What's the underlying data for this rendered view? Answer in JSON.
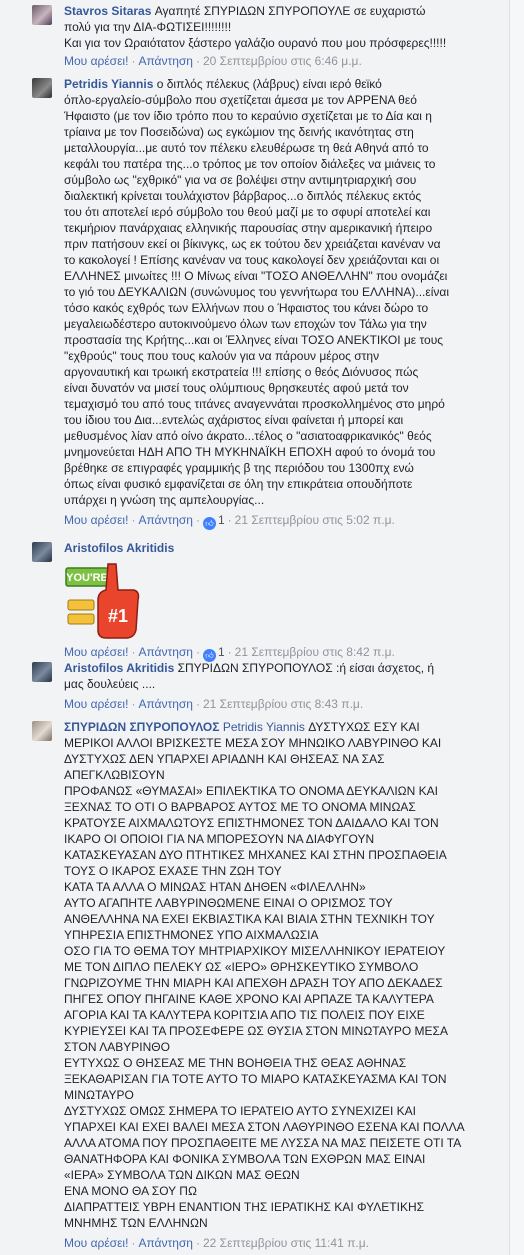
{
  "actions": {
    "like": "Μου αρέσει!",
    "reply": "Απάντηση"
  },
  "comments": [
    {
      "author": "Stavros Sitaras",
      "lines": [
        "Αγαπητέ ΣΠΥΡΙΔΩΝ ΣΠΥΡΟΠΟΥΛΕ σε ευχαριστώ",
        "πολύ για την ΔΙΑ-ΦΩΤΙΣΕΙ!!!!!!!!",
        "Και για τον Ωραιότατον ξάστερο γαλάζιο ουρανό που μου πρόσφερες!!!!!"
      ],
      "timestamp": "20 Σεπτεμβρίου στις 6:46 μ.μ."
    },
    {
      "author": "Petridis Yiannis",
      "lines": [
        "ο διπλός πέλεκυς (λάβρυς) είναι ιερό θεϊκό",
        "όπλο-εργαλείο-σύμβολο που σχετίζεται άμεσα με τον ΑΡΡΕΝΑ θεό",
        "Ήφαιστο (με τον ίδιο τρόπο που το κεραύνιο σχετίζεται με το Δία και η",
        "τρίαινα με τον Ποσειδώνα) ως εγκώμιον της δεινής ικανότητας στη",
        "μεταλλουργία...με αυτό τον πέλεκυ ελευθέρωσε τη θεά Αθηνά από το",
        "κεφάλι του πατέρα της...ο τρόπος με τον οποίον διάλεξες να μιάνεις το",
        "σύμβολο ως \"εχθρικό\" για να σε βολέψει στην αντιμητριαρχική σου",
        "διαλεκτική κρίνεται τουλάχιστον βάρβαρος...ο διπλός πέλεκυς εκτός",
        "του ότι αποτελεί ιερό σύμβολο του θεού μαζί με το σφυρί αποτελεί και",
        "τεκμήριον πανάρχαιας ελληνικής παρουσίας στην αμερικανική ήπειρο",
        "πριν πατήσουν εκεί οι βίκινγκς, ως εκ τούτου δεν χρειάζεται κανέναν να",
        "το κακολογεί ! Επίσης κανέναν να τους κακολογεί δεν χρειάζονται και οι",
        "ΕΛΛΗΝΕΣ μινωίτες !!! Ο Μίνως είναι \"ΤΟΣΟ ΑΝΘΕΛΛΗΝ\" που ονομάζει",
        "το γιό του ΔΕΥΚΑΛΙΩΝ (συνώνυμος του γεννήτωρα του ΕΛΛΗΝΑ)...είναι",
        "τόσο κακός εχθρός των Ελλήνων που ο Ήφαιστος του κάνει δώρο το",
        "μεγαλειωδέστερο αυτοκινούμενο όλων των εποχών τον Τάλω για την",
        "προστασία της Κρήτης...και οι Έλληνες είναι ΤΟΣΟ ΑΝΕΚΤΙΚΟΙ με τους",
        "\"εχθρούς\" τους που τους καλούν για να πάρουν μέρος στην",
        "αργοναυτική και τρωική εκστρατεία !!! επίσης ο θεός Διόνυσος πώς",
        "είναι δυνατόν να μισεί τους ολύμπιους θρησκευτές αφού μετά τον",
        "τεμαχισμό του από τους τιτάνες αναγεννάται προσκολλημένος στο μηρό",
        "του ίδιου του Δια...εντελώς αχάριστος είναι φαίνεται ή μπορεί και",
        "μεθυσμένος λίαν από οίνο άκρατο...τέλος ο \"ασιατοαφρικανικός\" θεός",
        "μνημονεύεται ΗΔΗ ΑΠΟ ΤΗ ΜΥΚΗΝΑΪΚΗ ΕΠΟΧΗ αφού το όνομά του",
        "βρέθηκε σε επιγραφές γραμμικής β της περιόδου του 1300πχ ενώ",
        "όπως είναι φυσικό εμφανίζεται σε όλη την επικράτεια οπουδήποτε",
        "υπάρχει η γνώση της αμπελουργίας..."
      ],
      "likes": "1",
      "timestamp": "21 Σεπτεμβρίου στις 5:02 π.μ."
    },
    {
      "author": "Aristofilos Akritidis",
      "sticker_text": "YOU'RE #1",
      "likes": "1",
      "timestamp": "21 Σεπτεμβρίου στις 8:42 π.μ."
    },
    {
      "author": "Aristofilos Akritidis",
      "lines": [
        "ΣΠΥΡΙΔΩΝ ΣΠΥΡΟΠΟΥΛΟΣ :ή είσαι άσχετος, ή",
        "μας δουλεύεις ...."
      ],
      "timestamp": "21 Σεπτεμβρίου στις 8:43 π.μ."
    },
    {
      "author": "ΣΠΥΡΙΔΩΝ ΣΠΥΡΟΠΟΥΛΟΣ",
      "mention": "Petridis Yiannis",
      "first_line_rest": "ΔΥΣΤΥΧΩΣ ΕΣΥ ΚΑΙ",
      "lines": [
        "ΜΕΡΙΚΟΙ ΑΛΛΟΙ ΒΡΙΣΚΕΣΤΕ ΜΕΣΑ ΣΟΥ ΜΗΝΩΙΚΟ ΛΑΒΥΡΙΝΘΟ ΚΑΙ",
        "ΔΥΣΤΥΧΩΣ ΔΕΝ ΥΠΑΡΧΕΙ ΑΡΙΑΔΝΗ ΚΑΙ ΘΗΣΕΑΣ ΝΑ ΣΑΣ",
        "ΑΠΕΓΚΛΩΒΙΣΟΥΝ",
        "ΠΡΟΦΑΝΩΣ «ΘΥΜΑΣΑΙ» ΕΠΙΛΕΚΤΙΚΑ ΤΟ ΟΝΟΜΑ ΔΕΥΚΑΛΙΩΝ ΚΑΙ",
        "ΞΕΧΝΑΣ ΤΟ ΟΤΙ Ο ΒΑΡΒΑΡΟΣ ΑΥΤΟΣ ΜΕ ΤΟ ΟΝΟΜΑ ΜΙΝΩΑΣ",
        "ΚΡΑΤΟΥΣΕ ΑΙΧΜΑΛΩΤΟΥΣ ΕΠΙΣΤΗΜΟΝΕΣ ΤΟΝ ΔΑΙΔΑΛΟ ΚΑΙ ΤΟΝ",
        "ΙΚΑΡΟ ΟΙ ΟΠΟΙΟΙ ΓΙΑ ΝΑ ΜΠΟΡΕΣΟΥΝ ΝΑ ΔΙΑΦΥΓΟΥΝ",
        "ΚΑΤΑΣΚΕΥΑΣΑΝ ΔΥΟ ΠΤΗΤΙΚΕΣ ΜΗΧΑΝΕΣ ΚΑΙ ΣΤΗΝ ΠΡΟΣΠΑΘΕΙΑ",
        "ΤΟΥΣ Ο ΙΚΑΡΟΣ ΕΧΑΣΕ ΤΗΝ ΖΩΗ ΤΟΥ",
        "ΚΑΤΑ ΤΑ ΑΛΛΑ Ο ΜΙΝΩΑΣ ΗΤΑΝ ΔΗΘΕΝ «ΦΙΛΕΛΛΗΝ»",
        "ΑΥΤΟ ΑΓΑΠΗΤΕ ΛΑΒΥΡΙΝΘΩΜΕΝΕ ΕΙΝΑΙ Ο ΟΡΙΣΜΟΣ ΤΟΥ",
        "ΑΝΘΕΛΛΗΝΑ ΝΑ ΕΧΕΙ ΕΚΒΙΑΣΤΙΚΑ ΚΑΙ ΒΙΑΙΑ ΣΤΗΝ ΤΕΧΝΙΚΗ ΤΟΥ",
        "ΥΠΗΡΕΣΙΑ ΕΠΙΣΤΗΜΟΝΕΣ ΥΠΟ ΑΙΧΜΑΛΩΣΙΑ",
        "ΟΣΟ ΓΙΑ ΤΟ ΘΕΜΑ ΤΟΥ ΜΗΤΡΙΑΡΧΙΚΟΥ ΜΙΣΕΛΛΗΝΙΚΟΥ ΙΕΡΑΤΕΙΟΥ",
        "ΜΕ ΤΟΝ ΔΙΠΛΟ ΠΕΛΕΚΥ ΩΣ «ΙΕΡΟ» ΘΡΗΣΚΕΥΤΙΚΟ ΣΥΜΒΟΛΟ",
        "ΓΝΩΡΙΖΟΥΜΕ ΤΗΝ ΜΙΑΡΗ ΚΑΙ ΑΠΕΧΘΗ ΔΡΑΣΗ ΤΟΥ ΑΠΟ ΔΕΚΑΔΕΣ",
        "ΠΗΓΕΣ ΟΠΟΥ ΠΗΓΑΙΝΕ ΚΑΘΕ ΧΡΟΝΟ ΚΑΙ ΑΡΠΑΖΕ ΤΑ ΚΑΛΥΤΕΡΑ",
        "ΑΓΟΡΙΑ ΚΑΙ ΤΑ ΚΑΛΥΤΕΡΑ ΚΟΡΙΤΣΙΑ ΑΠΟ ΤΙΣ ΠΟΛΕΙΣ ΠΟΥ ΕΙΧΕ",
        "ΚΥΡΙΕΥΣΕΙ ΚΑΙ ΤΑ ΠΡΟΣΕΦΕΡΕ ΩΣ ΘΥΣΙΑ ΣΤΟΝ ΜΙΝΩΤΑΥΡΟ ΜΕΣΑ",
        "ΣΤΟΝ ΛΑΒΥΡΙΝΘΟ",
        "ΕΥΤΥΧΩΣ Ο ΘΗΣΕΑΣ ΜΕ ΤΗΝ ΒΟΗΘΕΙΑ ΤΗΣ ΘΕΑΣ ΑΘΗΝΑΣ",
        "ΞΕΚΑΘΑΡΙΣΑΝ ΓΙΑ ΤΟΤΕ ΑΥΤΟ ΤΟ ΜΙΑΡΟ ΚΑΤΑΣΚΕΥΑΣΜΑ ΚΑΙ ΤΟΝ",
        "ΜΙΝΩΤΑΥΡΟ",
        "ΔΥΣΤΥΧΩΣ ΟΜΩΣ ΣΗΜΕΡΑ ΤΟ ΙΕΡΑΤΕΙΟ ΑΥΤΟ ΣΥΝΕΧΙΖΕΙ ΚΑΙ",
        "ΥΠΑΡΧΕΙ ΚΑΙ ΕΧΕΙ ΒΑΛΕΙ ΜΕΣΑ ΣΤΟΝ ΛΑΘΥΡΙΝΘΟ ΕΣΕΝΑ ΚΑΙ ΠΟΛΛΑ",
        "ΑΛΛΑ ΑΤΟΜΑ ΠΟΥ ΠΡΟΣΠΑΘΕΙΤΕ ΜΕ ΛΥΣΣΑ ΝΑ ΜΑΣ ΠΕΙΣΕΤΕ ΟΤΙ ΤΑ",
        "ΘΑΝΑΤΗΦΟΡΑ ΚΑΙ ΦΟΝΙΚΑ ΣΥΜΒΟΛΑ ΤΩΝ ΕΧΘΡΩΝ ΜΑΣ ΕΙΝΑΙ",
        "«ΙΕΡΑ» ΣΥΜΒΟΛΑ ΤΩΝ ΔΙΚΩΝ ΜΑΣ ΘΕΩΝ",
        "ΕΝΑ ΜΟΝΟ ΘΑ ΣΟΥ ΠΩ",
        "ΔΙΑΠΡΑΤΤΕΙΣ ΥΒΡΗ ΕΝΑΝΤΙΟΝ ΤΗΣ ΙΕΡΑΤΙΚΗΣ ΚΑΙ ΦΥΛΕΤΙΚΗΣ",
        "ΜΝΗΜΗΣ ΤΩΝ ΕΛΛΗΝΩΝ"
      ],
      "timestamp": "22 Σεπτεμβρίου στις 11:41 π.μ."
    }
  ]
}
